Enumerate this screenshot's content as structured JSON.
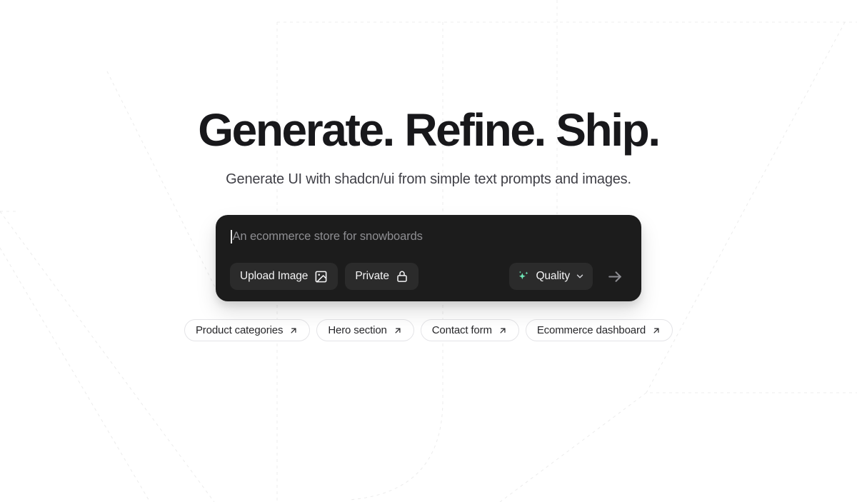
{
  "hero": {
    "headline": "Generate. Refine. Ship.",
    "subtitle": "Generate UI with shadcn/ui from simple text prompts and images."
  },
  "composer": {
    "prompt_value": "",
    "prompt_placeholder": "An ecommerce store for snowboards",
    "caret_visible": true,
    "upload_button": {
      "label": "Upload Image",
      "icon": "image-icon"
    },
    "privacy_button": {
      "label": "Private",
      "icon": "lock-icon"
    },
    "quality_selector": {
      "label": "Quality",
      "icon": "sparkles-icon",
      "chevron": "chevron-down-icon",
      "options": [
        "Quality"
      ]
    },
    "submit_button": {
      "icon": "arrow-right-icon"
    },
    "colors": {
      "surface": "#1c1c1c",
      "button_surface": "#2b2b2b",
      "text": "#f4f4f5",
      "placeholder": "#8e8e92",
      "sparkle_accent": "#6ee7b7"
    }
  },
  "suggestions": {
    "chips": [
      {
        "label": "Product categories",
        "icon": "arrow-up-right-icon"
      },
      {
        "label": "Hero section",
        "icon": "arrow-up-right-icon"
      },
      {
        "label": "Contact form",
        "icon": "arrow-up-right-icon"
      },
      {
        "label": "Ecommerce dashboard",
        "icon": "arrow-up-right-icon"
      }
    ]
  },
  "background": {
    "line_color": "#ececec",
    "style": "dashed"
  }
}
